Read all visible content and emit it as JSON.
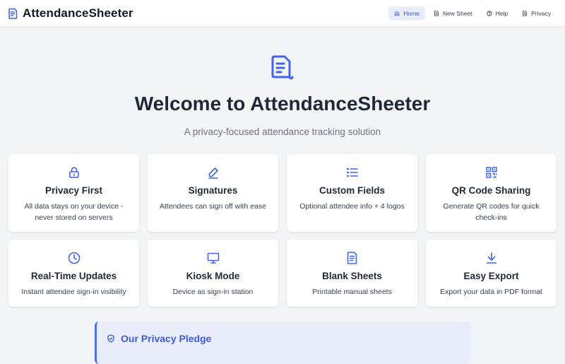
{
  "app": {
    "name": "AttendanceSheeter",
    "accent_color": "#4263eb",
    "icon": "document-icon"
  },
  "nav": {
    "items": [
      {
        "label": "Home",
        "icon": "home-icon",
        "active": true
      },
      {
        "label": "New Sheet",
        "icon": "document-icon",
        "active": false
      },
      {
        "label": "Help",
        "icon": "help-circle-icon",
        "active": false
      },
      {
        "label": "Privacy",
        "icon": "document-icon",
        "active": false
      }
    ]
  },
  "hero": {
    "icon": "document-icon",
    "title": "Welcome to AttendanceSheeter",
    "subtitle": "A privacy-focused attendance tracking solution"
  },
  "features": [
    {
      "icon": "lock-icon",
      "title": "Privacy First",
      "description": "All data stays on your device - never stored on servers"
    },
    {
      "icon": "pencil-icon",
      "title": "Signatures",
      "description": "Attendees can sign off with ease"
    },
    {
      "icon": "list-icon",
      "title": "Custom Fields",
      "description": "Optional attendee info + 4 logos"
    },
    {
      "icon": "qr-code-icon",
      "title": "QR Code Sharing",
      "description": "Generate QR codes for quick check-ins"
    },
    {
      "icon": "clock-icon",
      "title": "Real-Time Updates",
      "description": "Instant attendee sign-in visibility"
    },
    {
      "icon": "monitor-icon",
      "title": "Kiosk Mode",
      "description": "Device as sign-in station"
    },
    {
      "icon": "document-icon",
      "title": "Blank Sheets",
      "description": "Printable manual sheets"
    },
    {
      "icon": "download-icon",
      "title": "Easy Export",
      "description": "Export your data in PDF format"
    }
  ],
  "pledge": {
    "icon": "shield-check-icon",
    "title": "Our Privacy Pledge"
  }
}
